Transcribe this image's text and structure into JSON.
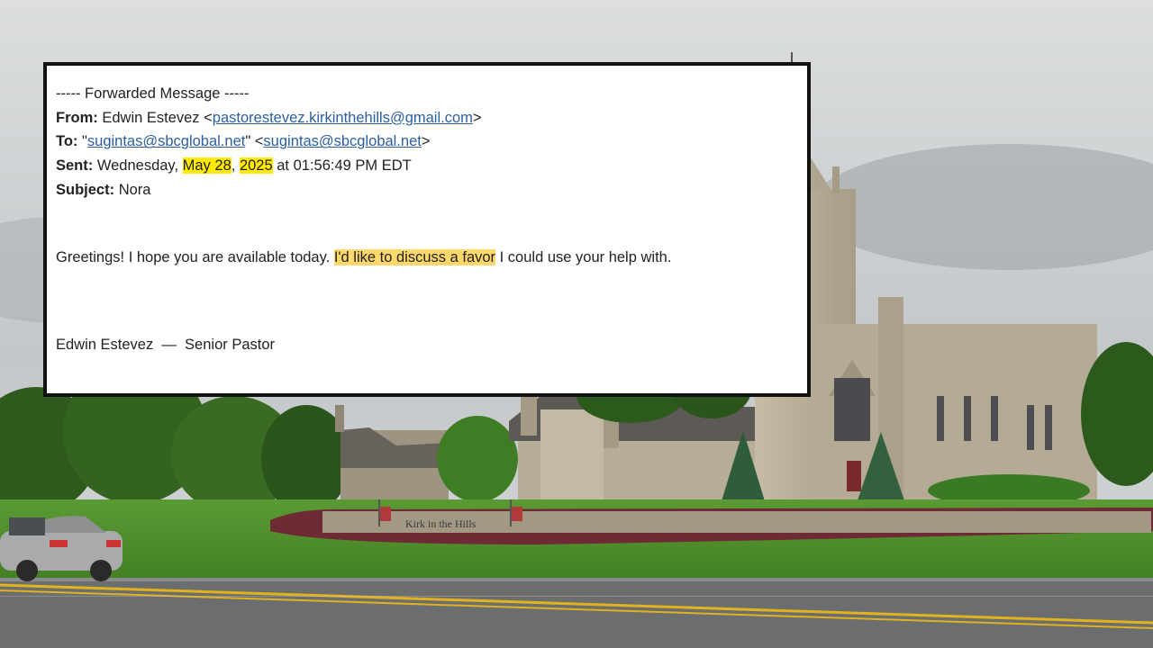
{
  "email": {
    "header": "----- Forwarded Message -----",
    "from_label": "From:",
    "from_name": "Edwin Estevez <",
    "from_email": "pastorestevez.kirkinthehills@gmail.com",
    "from_close": ">",
    "to_label": "To:",
    "to_open": "\"",
    "to_email_1": "sugintas@sbcglobal.net",
    "to_mid": "\" <",
    "to_email_2": "sugintas@sbcglobal.net",
    "to_close": ">",
    "sent_label": "Sent:",
    "sent_day": "Wednesday,",
    "sent_month_day": "May 28",
    "sent_comma": ",",
    "sent_year": "2025",
    "sent_time": "at 01:56:49 PM EDT",
    "subject_label": "Subject:",
    "subject_value": "Nora",
    "body_start": "Greetings! I hope you are available today.",
    "body_highlight": "I'd like to discuss a favor",
    "body_end": "I could use your help with.",
    "signature": "Edwin Estevez  —  Senior Pastor"
  },
  "sign": {
    "text": "Kirk in the Hills"
  },
  "colors": {
    "highlight_yellow": "#ffea00",
    "highlight_orange": "#ffd86b",
    "link": "#2b5f9e",
    "sky": "#c9cccd",
    "grass": "#4f8a2c",
    "stone": "#b5ab96"
  }
}
